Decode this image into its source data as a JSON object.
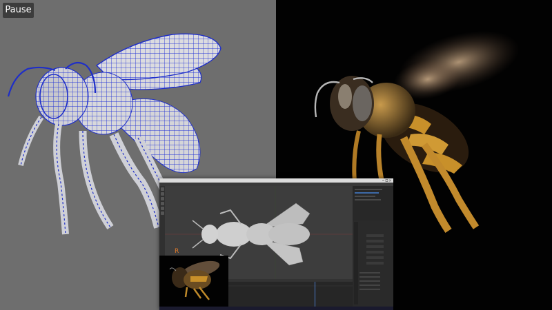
{
  "controls": {
    "pause_label": "Pause"
  },
  "colors": {
    "wireframe_background": "#6e6e6e",
    "photo_background": "#020202",
    "wireframe_edge": "#2030d8",
    "mesh_fill": "#d8d8d8",
    "bee_fur": "#c8902a",
    "blender_ui": "#2b2b2b"
  },
  "icons": {
    "pause": "pause-button",
    "blender_tools": [
      "cursor-icon",
      "move-icon",
      "rotate-icon",
      "scale-icon",
      "transform-icon",
      "annotate-icon"
    ],
    "taskbar": [
      "start-icon",
      "search-icon",
      "task-view-icon",
      "explorer-icon",
      "browser-icon",
      "blender-icon"
    ]
  }
}
